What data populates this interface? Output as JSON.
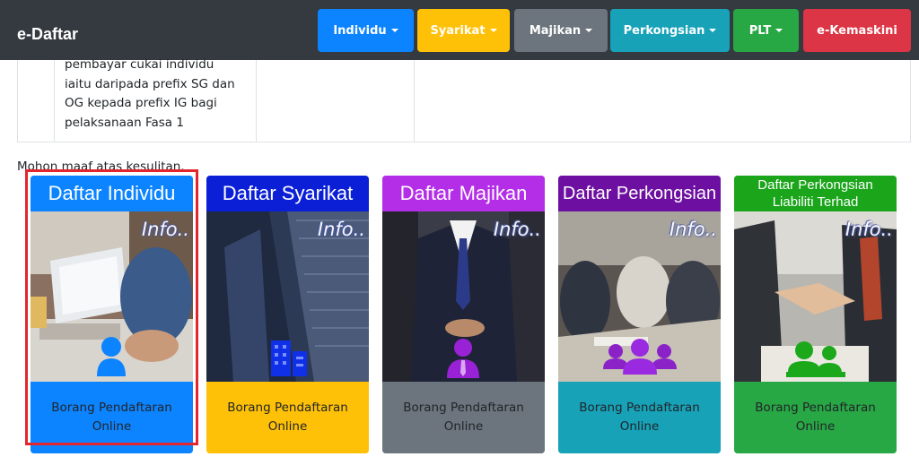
{
  "navbar": {
    "brand": "e-Daftar",
    "items": [
      {
        "label": "Individu",
        "color": "#0d84ff",
        "dropdown": true
      },
      {
        "label": "Syarikat",
        "color": "#ffc107",
        "dropdown": true
      },
      {
        "label": "Majikan",
        "color": "#6c757d",
        "dropdown": true
      },
      {
        "label": "Perkongsian",
        "color": "#17a2b8",
        "dropdown": true
      },
      {
        "label": "PLT",
        "color": "#28a745",
        "dropdown": true
      },
      {
        "label": "e-Kemaskini",
        "color": "#dc3545",
        "dropdown": false
      }
    ]
  },
  "table": {
    "text": "pembayar cukai individu iaitu daripada prefix SG dan OG kepada prefix IG bagi pelaksanaan Fasa 1"
  },
  "apology": "Mohon maaf atas kesulitan.",
  "cards": [
    {
      "title": "Daftar Individu",
      "info": "Info..",
      "footer": "Borang Pendaftaran Online",
      "color": "#0d84ff",
      "icon": "person-icon"
    },
    {
      "title": "Daftar Syarikat",
      "info": "Info..",
      "footer": "Borang Pendaftaran Online",
      "color": "#ffc107",
      "icon": "building-icon"
    },
    {
      "title": "Daftar Majikan",
      "info": "Info..",
      "footer": "Borang Pendaftaran Online",
      "color": "#6c757d",
      "icon": "businessman-icon"
    },
    {
      "title": "Daftar Perkongsian",
      "info": "Info..",
      "footer": "Borang Pendaftaran Online",
      "color": "#17a2b8",
      "icon": "group-icon"
    },
    {
      "title": "Daftar Perkongsian Liabiliti Terhad",
      "info": "Info..",
      "footer": "Borang Pendaftaran Online",
      "color": "#28a745",
      "icon": "handshake-group-icon"
    }
  ]
}
